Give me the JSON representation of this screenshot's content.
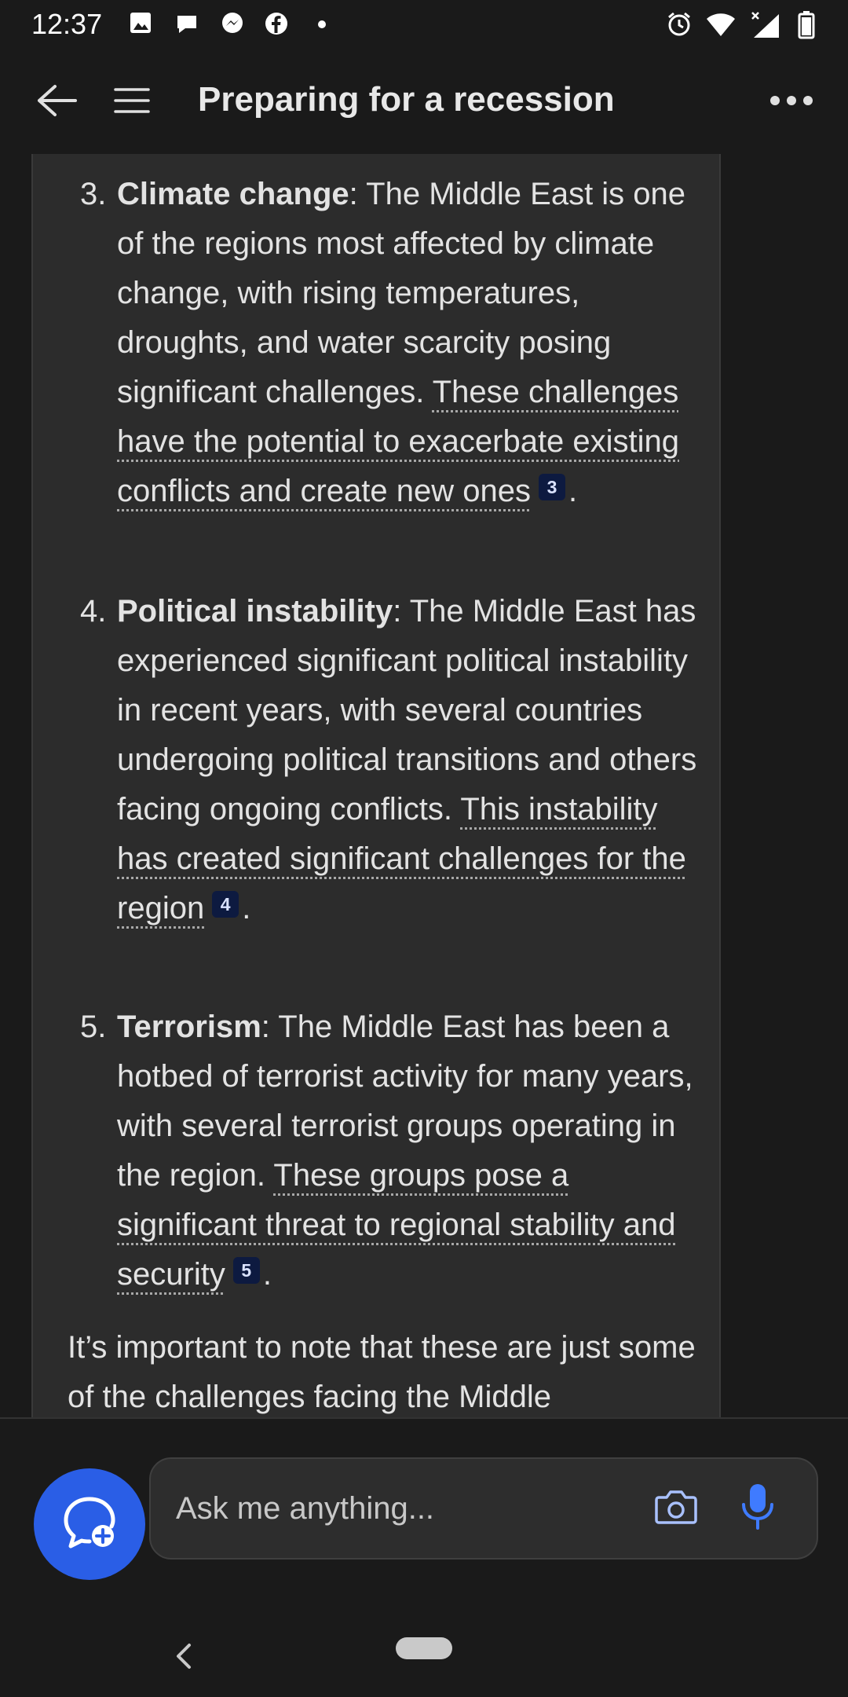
{
  "status_bar": {
    "time": "12:37",
    "left_icons": [
      "image-icon",
      "chat-bubble-icon",
      "messenger-icon",
      "facebook-icon",
      "dot-icon"
    ],
    "right_icons": [
      "alarm-icon",
      "wifi-icon",
      "signal-icon",
      "battery-icon"
    ]
  },
  "app_bar": {
    "title": "Preparing for a recession",
    "back_icon": "back-arrow-icon",
    "menu_icon": "hamburger-menu-icon",
    "more_icon": "more-horizontal-icon"
  },
  "content": {
    "items": [
      {
        "number": "3.",
        "heading": "Climate change",
        "text": ": The Middle East is one of the regions most affected by climate change, with rising temperatures, droughts, and water scarcity posing significant challenges. ",
        "cited_text": "These challenges have the potential to exacerbate existing conflicts and create new ones",
        "citation": "3",
        "end": "."
      },
      {
        "number": "4.",
        "heading": "Political instability",
        "text": ": The Middle East has experienced significant political instability in recent years, with several countries undergoing political transitions and others facing ongoing conflicts. ",
        "cited_text": "This instability has created significant challenges for the region",
        "citation": "4",
        "end": "."
      },
      {
        "number": "5.",
        "heading": "Terrorism",
        "text": ": The Middle East has been a hotbed of terrorist activity for many years, with several terrorist groups operating in the region. ",
        "cited_text": "These groups pose a significant threat to regional stability and security",
        "citation": "5",
        "end": "."
      }
    ],
    "closing": "It’s important to note that these are just some of the challenges facing the Middle"
  },
  "composer": {
    "placeholder": "Ask me anything...",
    "new_chat_icon": "new-chat-icon",
    "camera_icon": "camera-icon",
    "mic_icon": "microphone-icon",
    "accent_color": "#2a5ee6"
  },
  "nav_bar": {
    "back_icon": "nav-back-icon",
    "home_icon": "home-pill-icon"
  }
}
